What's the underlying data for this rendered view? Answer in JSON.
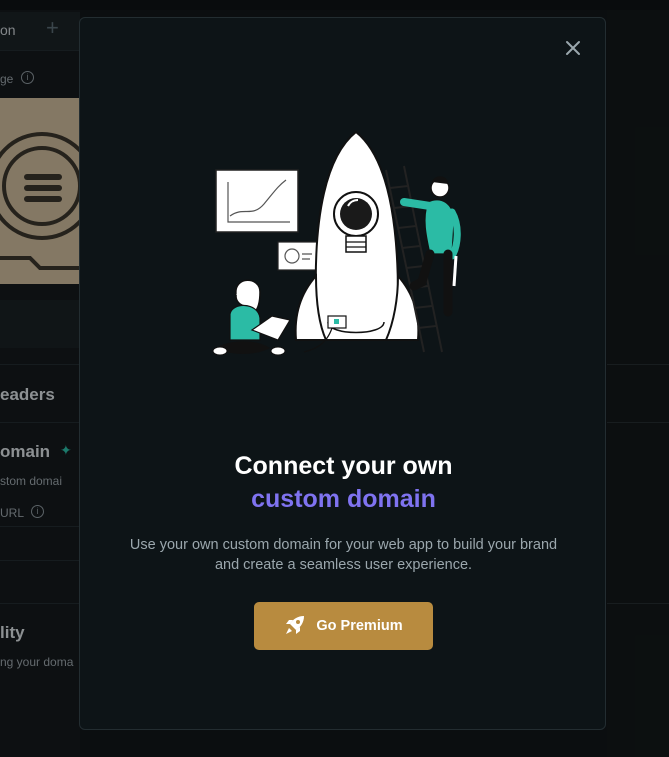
{
  "background": {
    "tab_label": "on",
    "field_label": "ge",
    "section_headers": "eaders",
    "domain_heading": "omain",
    "domain_desc": "stom domai",
    "url_label": "URL",
    "quality_heading": "lity",
    "quality_desc": "ng your doma"
  },
  "modal": {
    "title": "Connect your own",
    "title_accent": "custom domain",
    "description": "Use your own custom domain for your web app to build your brand and create a seamless user experience.",
    "cta_label": "Go Premium",
    "close_icon": "close-icon",
    "cta_icon": "rocket-icon",
    "illustration": "rocket-team-illustration"
  },
  "colors": {
    "accent": "#7f73f0",
    "cta": "#b88b3f",
    "teal": "#2bbba5",
    "modal_bg": "#0d1417"
  }
}
